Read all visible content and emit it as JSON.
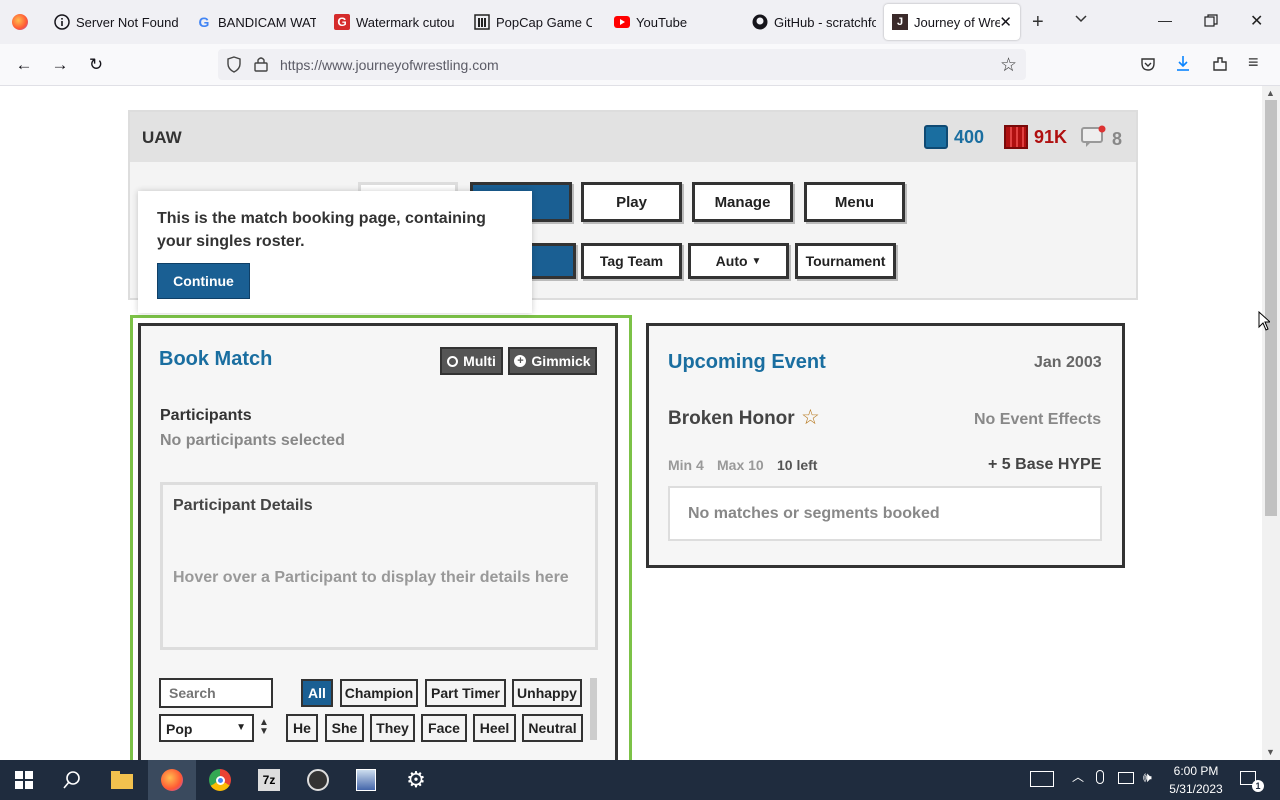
{
  "browser": {
    "tabs": [
      {
        "title": "Server Not Found",
        "icon": "info-icon"
      },
      {
        "title": "BANDICAM WATE",
        "icon": "google-icon"
      },
      {
        "title": "Watermark cutout",
        "icon": "g-red-icon"
      },
      {
        "title": "PopCap Game Co",
        "icon": "popcap-icon"
      },
      {
        "title": "YouTube",
        "icon": "youtube-icon"
      },
      {
        "title": "GitHub - scratchfo",
        "icon": "github-icon"
      },
      {
        "title": "Journey of Wre",
        "icon": "j-icon"
      }
    ],
    "url": "https://www.journeyofwrestling.com"
  },
  "header": {
    "brand": "UAW",
    "credits": "400",
    "money": "91K",
    "messages": "8"
  },
  "nav": {
    "row1": [
      "Play",
      "Manage",
      "Menu"
    ],
    "row2": [
      "Tag Team",
      "Auto",
      "Tournament"
    ]
  },
  "tooltip": {
    "text": "This is the match booking page, containing your singles roster.",
    "button": "Continue"
  },
  "book_match": {
    "title": "Book Match",
    "multi": "Multi",
    "gimmick": "Gimmick",
    "participants_label": "Participants",
    "participants_empty": "No participants selected",
    "details_title": "Participant Details",
    "details_hint": "Hover over a Participant to display their details here",
    "search_placeholder": "Search",
    "sort_value": "Pop",
    "filters_row1": [
      "All",
      "Champion",
      "Part Timer",
      "Unhappy"
    ],
    "filters_row2": [
      "He",
      "She",
      "They",
      "Face",
      "Heel",
      "Neutral"
    ]
  },
  "event": {
    "title": "Upcoming Event",
    "date": "Jan 2003",
    "name": "Broken Honor",
    "effects": "No Event Effects",
    "min": "Min 4",
    "max": "Max 10",
    "left": "10 left",
    "hype": "+ 5 Base HYPE",
    "empty": "No matches or segments booked"
  },
  "taskbar": {
    "time": "6:00 PM",
    "date": "5/31/2023",
    "notifications": "1"
  },
  "colors": {
    "accent": "#1a5f93",
    "title_blue": "#1a6ea0",
    "money_red": "#b01010",
    "green_border": "#7cc247"
  }
}
